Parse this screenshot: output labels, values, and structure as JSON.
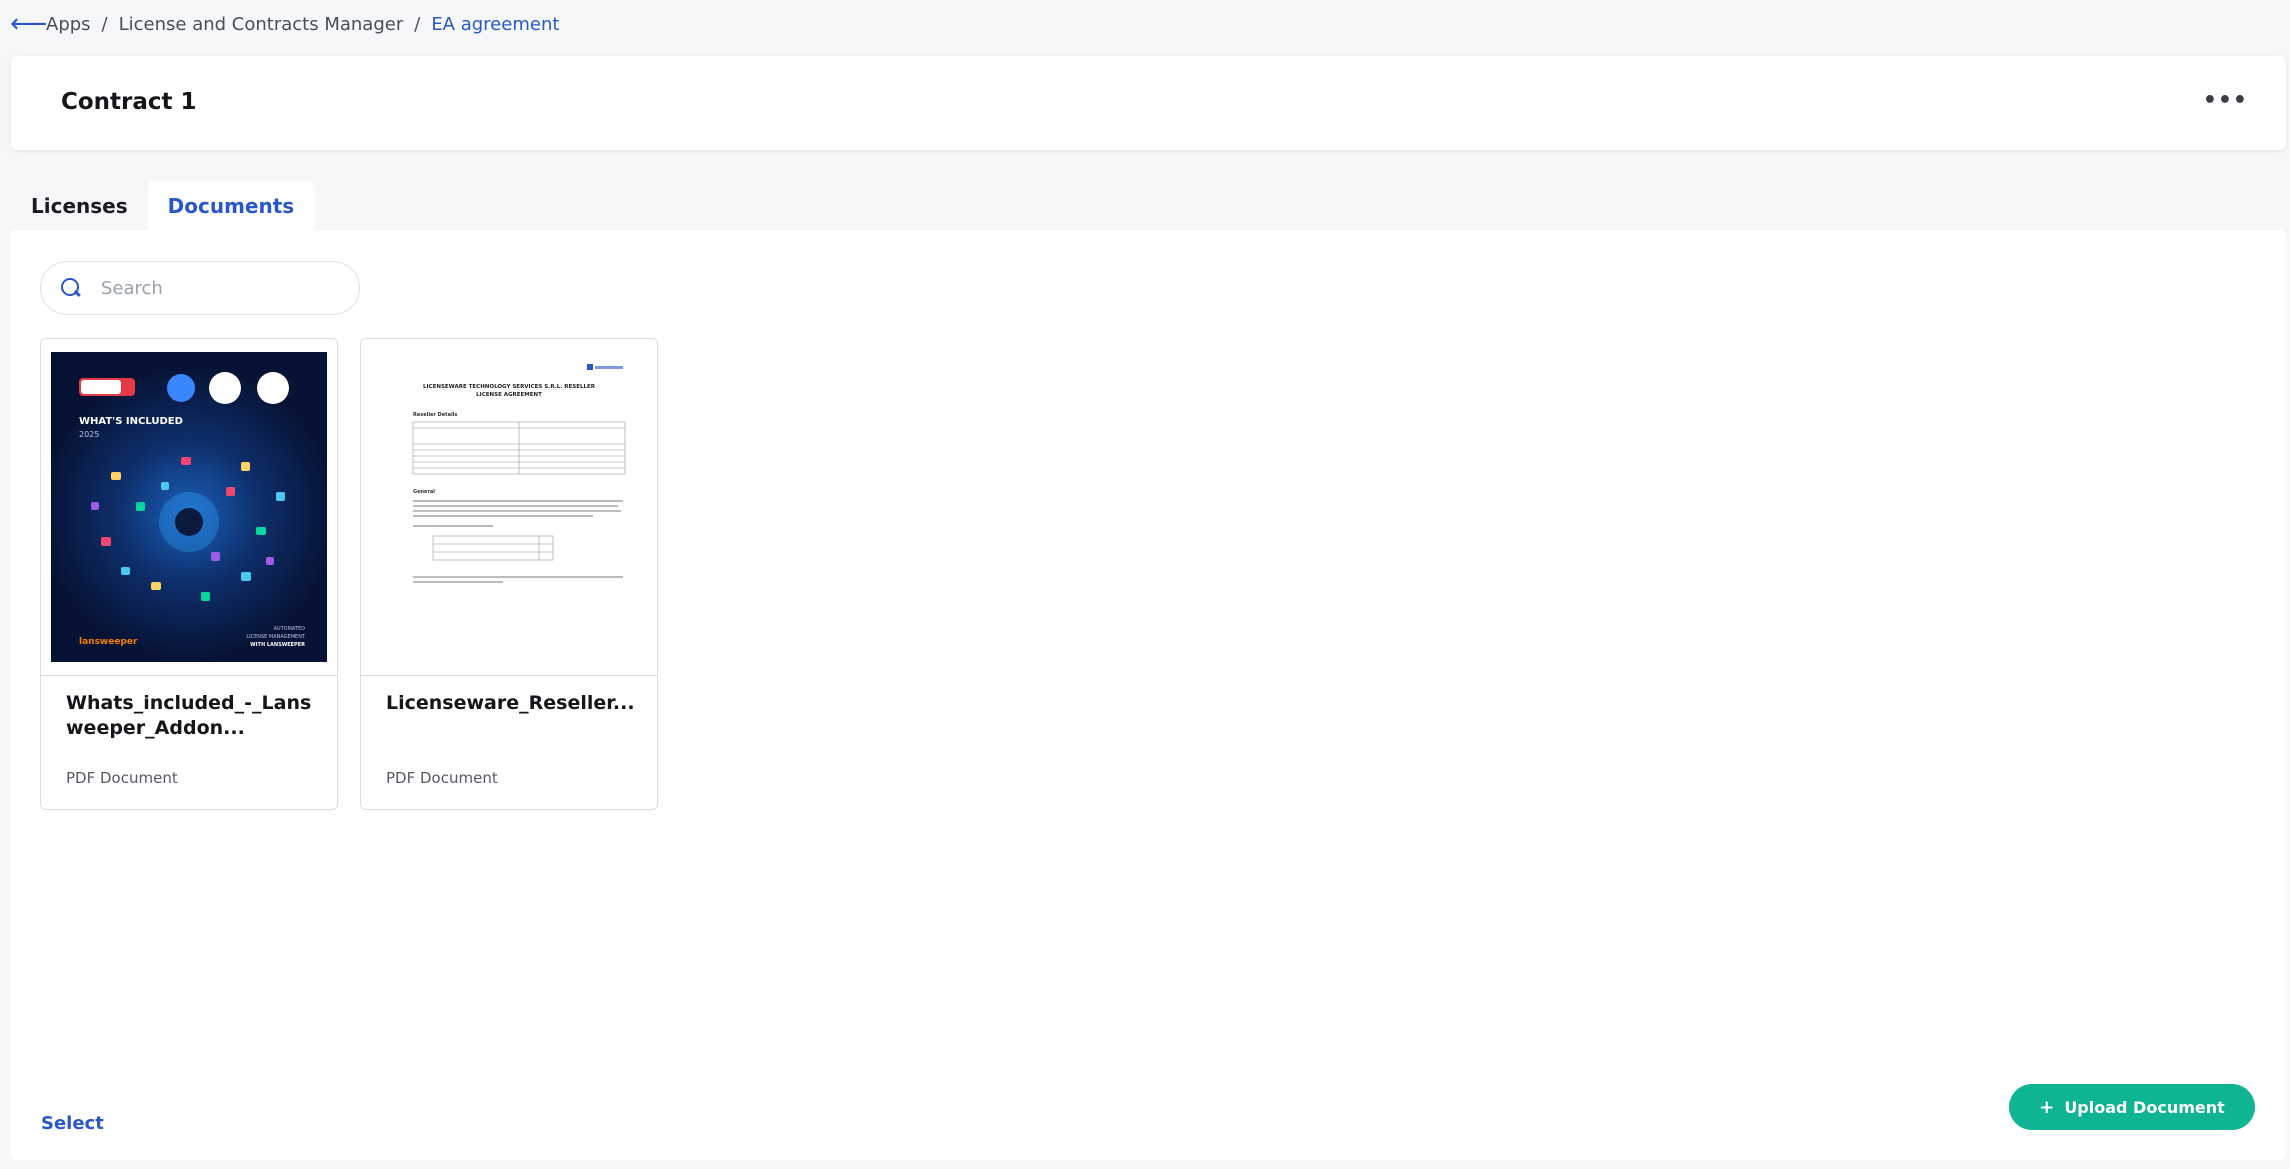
{
  "breadcrumb": {
    "back_icon": "arrow-left-icon",
    "items": [
      "Apps",
      "License and Contracts Manager",
      "EA agreement"
    ],
    "separator": "/"
  },
  "header": {
    "title": "Contract 1",
    "more_icon": "ellipsis-icon",
    "more_label": "•••"
  },
  "tabs": [
    {
      "label": "Licenses",
      "active": false
    },
    {
      "label": "Documents",
      "active": true
    }
  ],
  "search": {
    "placeholder": "Search",
    "value": "",
    "icon": "search-icon"
  },
  "documents": [
    {
      "name": "Whats_included_-_Lansweeper_Addon...",
      "type": "PDF Document",
      "thumbnail": {
        "style": "dark",
        "heading": "WHAT'S INCLUDED",
        "year": "2025",
        "brand": "lansweeper",
        "footer": [
          "AUTOMATED",
          "LICENSE MANAGEMENT",
          "WITH LANSWEEPER"
        ]
      }
    },
    {
      "name": "Licenseware_Reseller...",
      "type": "PDF Document",
      "thumbnail": {
        "style": "paper",
        "heading_line1": "LICENSEWARE TECHNOLOGY SERVICES S.R.L. RESELLER",
        "heading_line2": "LICENSE AGREEMENT",
        "section1": "Reseller Details",
        "section2": "General"
      }
    }
  ],
  "footer": {
    "select_label": "Select",
    "upload_label": "Upload Document",
    "upload_icon": "plus-icon"
  },
  "colors": {
    "accent": "#2a57c8",
    "upload": "#0fb493",
    "background": "#f6f7f9"
  }
}
